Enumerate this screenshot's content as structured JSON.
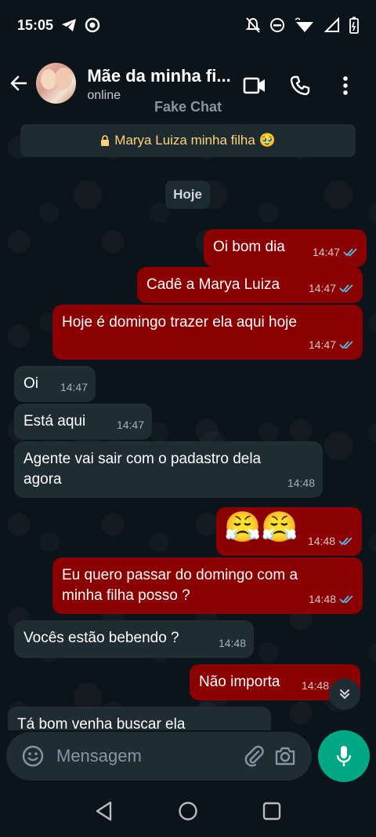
{
  "status_bar": {
    "time": "15:05"
  },
  "header": {
    "contact_name": "Mãe da minha fi...",
    "contact_status": "online",
    "watermark": "Fake Chat"
  },
  "chat": {
    "encryption_notice": "Marya Luiza minha filha 🥹",
    "date_chip": "Hoje",
    "messages": [
      {
        "direction": "out",
        "text": "Oi bom dia",
        "time": "14:47",
        "read": true
      },
      {
        "direction": "out",
        "text": "Cadê a Marya Luiza",
        "time": "14:47",
        "read": true
      },
      {
        "direction": "out",
        "text": "Hoje é domingo trazer ela aqui hoje",
        "time": "14:47",
        "read": true
      },
      {
        "direction": "in",
        "text": "Oi",
        "time": "14:47"
      },
      {
        "direction": "in",
        "text": "Está aqui",
        "time": "14:47"
      },
      {
        "direction": "in",
        "text": "Agente vai sair com o padastro dela agora",
        "time": "14:48"
      },
      {
        "direction": "out",
        "text": "😤😤",
        "time": "14:48",
        "read": true
      },
      {
        "direction": "out",
        "text": "Eu quero passar do domingo com a minha filha posso ?",
        "time": "14:48",
        "read": true
      },
      {
        "direction": "in",
        "text": "Vocês estão bebendo ?",
        "time": "14:48"
      },
      {
        "direction": "out",
        "text": "Não importa",
        "time": "14:48",
        "read": true
      },
      {
        "direction": "in",
        "text": "Tá bom venha buscar ela",
        "time": ""
      }
    ]
  },
  "composer": {
    "placeholder": "Mensagem"
  },
  "colors": {
    "outgoing_bubble": "#8b0000",
    "incoming_bubble": "#202c33",
    "accent": "#00a884",
    "read_ticks": "#53bdeb"
  }
}
